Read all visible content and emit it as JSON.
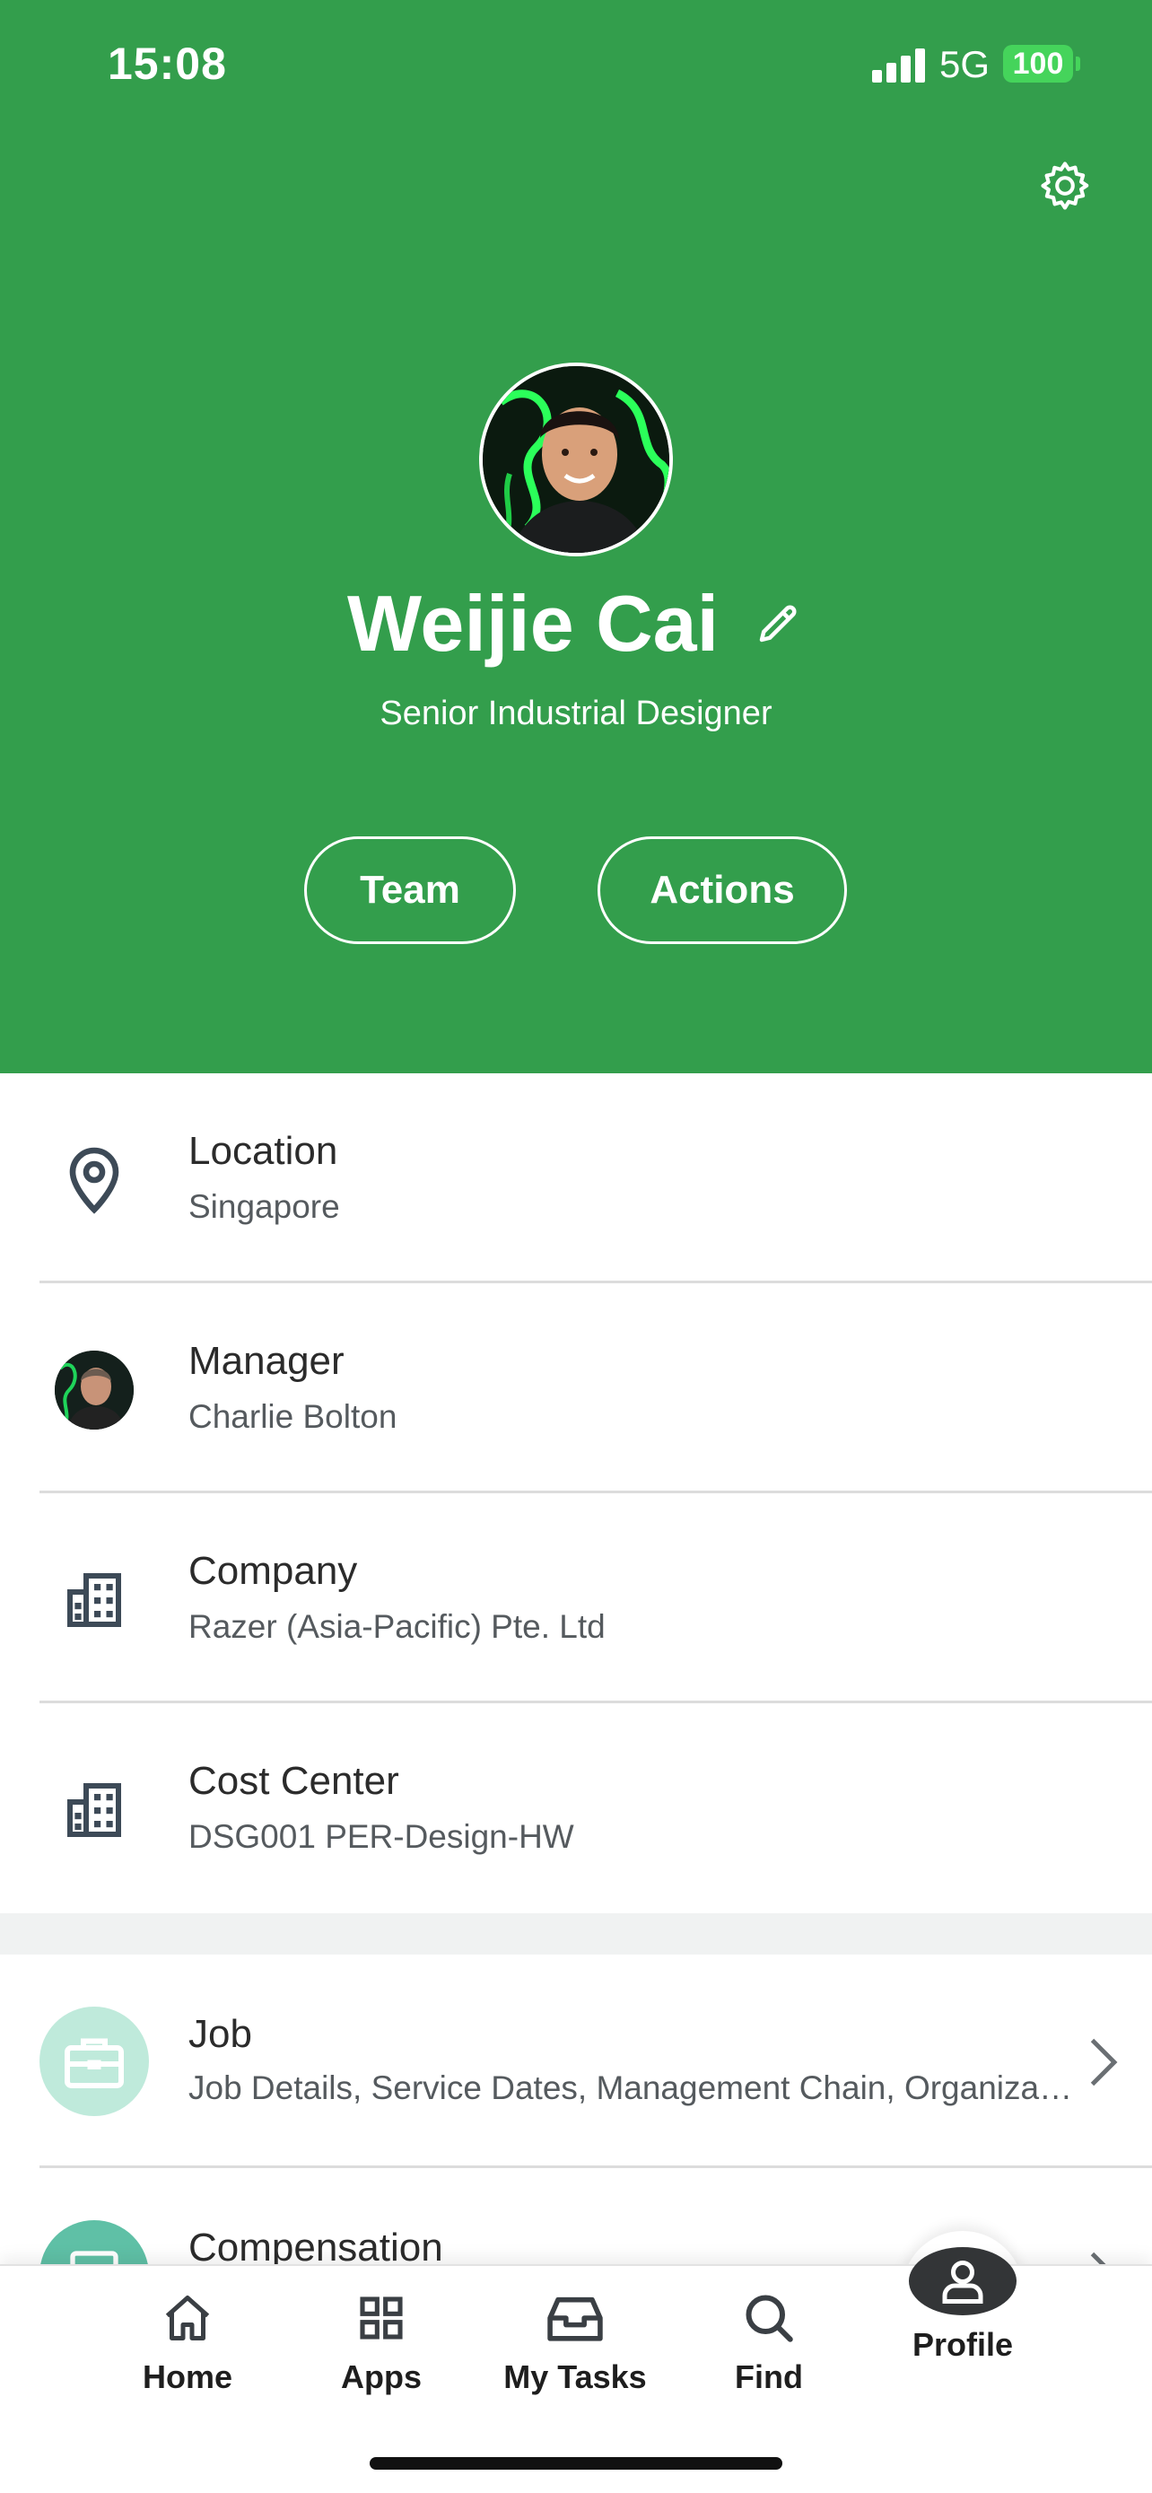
{
  "status_bar": {
    "time": "15:08",
    "network": "5G",
    "battery": "100"
  },
  "profile": {
    "name": "Weijie Cai",
    "job_title": "Senior Industrial Designer",
    "buttons": {
      "team": "Team",
      "actions": "Actions"
    }
  },
  "info": [
    {
      "label": "Location",
      "value": "Singapore",
      "icon": "location-pin-icon"
    },
    {
      "label": "Manager",
      "value": "Charlie Bolton",
      "icon": "manager-avatar"
    },
    {
      "label": "Company",
      "value": "Razer (Asia-Pacific) Pte. Ltd",
      "icon": "building-icon"
    },
    {
      "label": "Cost Center",
      "value": "DSG001 PER-Design-HW",
      "icon": "building-icon"
    }
  ],
  "nav_rows": [
    {
      "label": "Job",
      "value": "Job Details, Service Dates, Management Chain, Organizations",
      "icon": "briefcase-icon"
    },
    {
      "label": "Compensation",
      "value": "",
      "icon": "compensation-icon"
    }
  ],
  "tab_bar": {
    "home": "Home",
    "apps": "Apps",
    "tasks": "My Tasks",
    "find": "Find",
    "profile": "Profile"
  },
  "colors": {
    "header_green": "#339e4c",
    "battery_green": "#45d45b",
    "job_icon_bg": "#bfeadb",
    "compensation_icon_bg": "#5fc0a6"
  }
}
